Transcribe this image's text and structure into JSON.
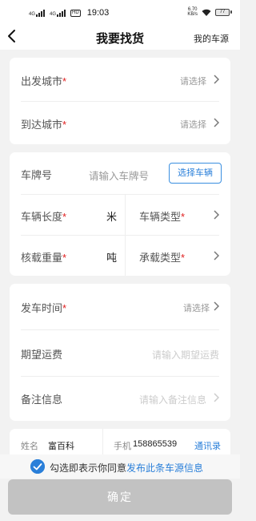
{
  "status_bar": {
    "sim1": "4G",
    "sim2": "4G",
    "hd": "HD",
    "time": "19:03",
    "net_speed_value": "6.70",
    "net_speed_unit": "KB/s",
    "battery": "77"
  },
  "nav": {
    "title": "我要找货",
    "right_link": "我的车源"
  },
  "route": {
    "departure_label": "出发城市",
    "departure_value": "请选择",
    "arrival_label": "到达城市",
    "arrival_value": "请选择"
  },
  "vehicle": {
    "plate_label": "车牌号",
    "plate_placeholder": "请输入车牌号",
    "select_vehicle_button": "选择车辆",
    "length_label": "车辆长度",
    "length_unit": "米",
    "type_label": "车辆类型",
    "weight_label": "核载重量",
    "weight_unit": "吨",
    "load_type_label": "承载类型"
  },
  "trip": {
    "departure_time_label": "发车时间",
    "departure_time_value": "请选择",
    "freight_label": "期望运费",
    "freight_placeholder": "请输入期望运费",
    "remarks_label": "备注信息",
    "remarks_placeholder": "请输入备注信息"
  },
  "contact": {
    "name_label": "姓名",
    "name_value": "富百科",
    "phone_label": "手机",
    "phone_value": "158865539",
    "address_book": "通讯录"
  },
  "agreement": {
    "prefix": "勾选即表示你同意",
    "link": "发布此条车源信息",
    "checked": true
  },
  "confirm_button": "确定",
  "colors": {
    "accent": "#2a7fd9",
    "required": "#e02020",
    "disabled_button": "#c2c2c2"
  }
}
